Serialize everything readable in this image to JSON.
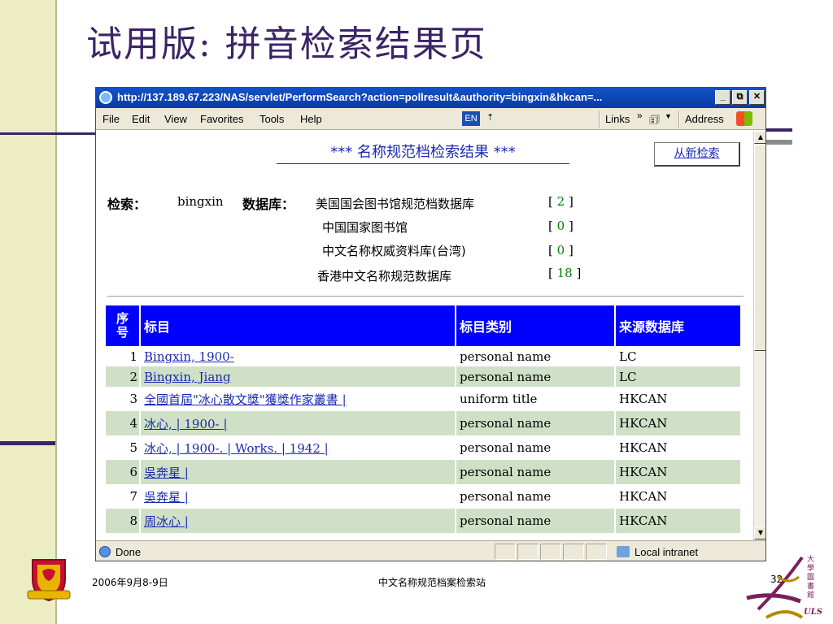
{
  "slide": {
    "title": "试用版: 拼音检索结果页",
    "footer_date": "2006年9月8-9日",
    "footer_center": "中文名称规范档案检索站",
    "page_number": "32",
    "logo_text": "ULS",
    "logo_chars": "大學圖書館"
  },
  "browser": {
    "title": "http://137.189.67.223/NAS/servlet/PerformSearch?action=pollresult&authority=bingxin&hkcan=...",
    "window_buttons": {
      "minimize": "_",
      "restore": "⧉",
      "close": "✕"
    },
    "menu": [
      "File",
      "Edit",
      "View",
      "Favorites",
      "Tools",
      "Help"
    ],
    "lang_badge": "EN",
    "links_label": "Links",
    "links_chevron": "»",
    "address_label": "Address",
    "status_text": "Done",
    "zone_text": "Local intranet"
  },
  "page": {
    "heading": "*** 名称规范档检索结果 ***",
    "new_search": "从新检索",
    "search_label": "检索：",
    "search_term": "bingxin",
    "database_label": "数据库：",
    "databases": [
      {
        "name": "美国国会图书馆规范档数据库",
        "count": "2"
      },
      {
        "name": "中国国家图书馆",
        "count": "0"
      },
      {
        "name": "中文名称权威资料库(台湾)",
        "count": "0"
      },
      {
        "name": "香港中文名称规范数据库",
        "count": "18"
      }
    ],
    "table": {
      "headers": {
        "seq_top": "序",
        "seq_bottom": "号",
        "heading": "标目",
        "type": "标目类别",
        "source": "来源数据库"
      },
      "rows": [
        {
          "seq": "1",
          "heading": "Bingxin, 1900-",
          "type": "personal name",
          "source": "LC"
        },
        {
          "seq": "2",
          "heading": "Bingxin, Jiang",
          "type": "personal name",
          "source": "LC"
        },
        {
          "seq": "3",
          "heading": "全國首屆\"冰心散文獎\"獲獎作家叢書 |",
          "type": "uniform title",
          "source": "HKCAN"
        },
        {
          "seq": "4",
          "heading": "冰心, | 1900- |",
          "type": "personal name",
          "source": "HKCAN"
        },
        {
          "seq": "5",
          "heading": "冰心, | 1900-. | Works. | 1942 |",
          "type": "personal name",
          "source": "HKCAN"
        },
        {
          "seq": "6",
          "heading": "吳奔星 |",
          "type": "personal name",
          "source": "HKCAN"
        },
        {
          "seq": "7",
          "heading": "吳奔星 |",
          "type": "personal name",
          "source": "HKCAN"
        },
        {
          "seq": "8",
          "heading": "周冰心 |",
          "type": "personal name",
          "source": "HKCAN"
        }
      ]
    }
  },
  "colors": {
    "accent": "#3a2466",
    "table_header": "#0000ff",
    "row_alt": "#cfe0c6",
    "link": "#1a2ab0",
    "count_number": "#008000"
  }
}
